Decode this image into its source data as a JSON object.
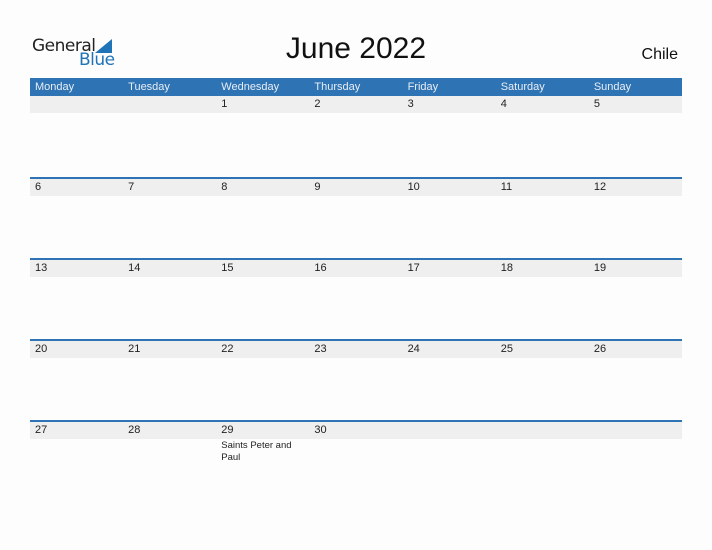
{
  "logo": {
    "general": "General",
    "blue": "Blue"
  },
  "title": "June 2022",
  "country": "Chile",
  "colors": {
    "header": "#2e73b3",
    "strip": "#efefef",
    "brand": "#1f73b7"
  },
  "weekdays": [
    "Monday",
    "Tuesday",
    "Wednesday",
    "Thursday",
    "Friday",
    "Saturday",
    "Sunday"
  ],
  "weeks": [
    {
      "days": [
        "",
        "",
        "1",
        "2",
        "3",
        "4",
        "5"
      ],
      "events": [
        "",
        "",
        "",
        "",
        "",
        "",
        ""
      ]
    },
    {
      "days": [
        "6",
        "7",
        "8",
        "9",
        "10",
        "11",
        "12"
      ],
      "events": [
        "",
        "",
        "",
        "",
        "",
        "",
        ""
      ]
    },
    {
      "days": [
        "13",
        "14",
        "15",
        "16",
        "17",
        "18",
        "19"
      ],
      "events": [
        "",
        "",
        "",
        "",
        "",
        "",
        ""
      ]
    },
    {
      "days": [
        "20",
        "21",
        "22",
        "23",
        "24",
        "25",
        "26"
      ],
      "events": [
        "",
        "",
        "",
        "",
        "",
        "",
        ""
      ]
    },
    {
      "days": [
        "27",
        "28",
        "29",
        "30",
        "",
        "",
        ""
      ],
      "events": [
        "",
        "",
        "Saints Peter and Paul",
        "",
        "",
        "",
        ""
      ]
    }
  ]
}
